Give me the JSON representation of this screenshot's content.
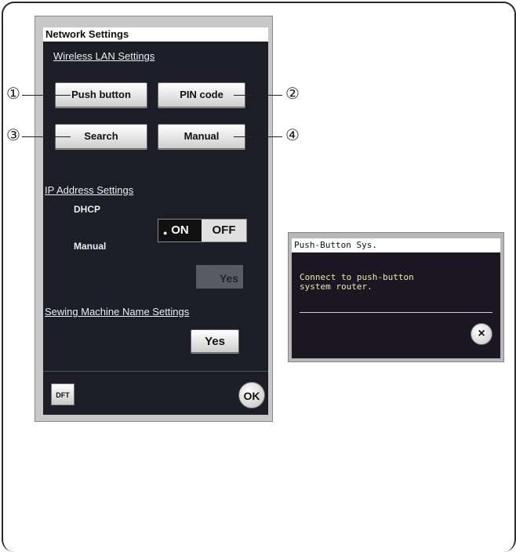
{
  "panel": {
    "title": "Network Settings",
    "wireless_section": "Wireless LAN Settings",
    "buttons": {
      "push_button": "Push button",
      "pin_code": "PIN code",
      "search": "Search",
      "manual": "Manual"
    },
    "ip_section": "IP Address Settings",
    "dhcp_label": "DHCP",
    "dhcp_on": "ON",
    "dhcp_off": "OFF",
    "dhcp_selected": "ON",
    "manual_label": "Manual",
    "manual_yes": "Yes",
    "machine_name_section": "Sewing Machine Name Settings",
    "machine_name_yes": "Yes",
    "dft_label": "DFT",
    "ok_label": "OK"
  },
  "callouts": [
    "①",
    "②",
    "③",
    "④"
  ],
  "popup": {
    "title": "Push-Button Sys.",
    "message_line1": "Connect to push-button",
    "message_line2": "system router.",
    "close_icon": "×"
  }
}
